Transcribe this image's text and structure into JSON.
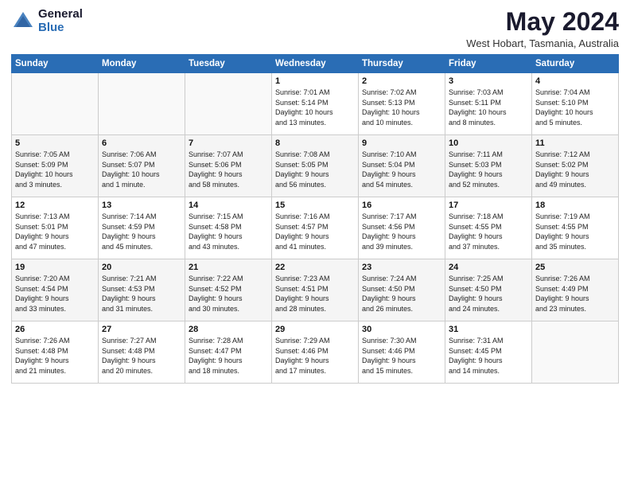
{
  "header": {
    "logo_general": "General",
    "logo_blue": "Blue",
    "month_title": "May 2024",
    "location": "West Hobart, Tasmania, Australia"
  },
  "weekdays": [
    "Sunday",
    "Monday",
    "Tuesday",
    "Wednesday",
    "Thursday",
    "Friday",
    "Saturday"
  ],
  "weeks": [
    [
      {
        "day": "",
        "info": ""
      },
      {
        "day": "",
        "info": ""
      },
      {
        "day": "",
        "info": ""
      },
      {
        "day": "1",
        "info": "Sunrise: 7:01 AM\nSunset: 5:14 PM\nDaylight: 10 hours\nand 13 minutes."
      },
      {
        "day": "2",
        "info": "Sunrise: 7:02 AM\nSunset: 5:13 PM\nDaylight: 10 hours\nand 10 minutes."
      },
      {
        "day": "3",
        "info": "Sunrise: 7:03 AM\nSunset: 5:11 PM\nDaylight: 10 hours\nand 8 minutes."
      },
      {
        "day": "4",
        "info": "Sunrise: 7:04 AM\nSunset: 5:10 PM\nDaylight: 10 hours\nand 5 minutes."
      }
    ],
    [
      {
        "day": "5",
        "info": "Sunrise: 7:05 AM\nSunset: 5:09 PM\nDaylight: 10 hours\nand 3 minutes."
      },
      {
        "day": "6",
        "info": "Sunrise: 7:06 AM\nSunset: 5:07 PM\nDaylight: 10 hours\nand 1 minute."
      },
      {
        "day": "7",
        "info": "Sunrise: 7:07 AM\nSunset: 5:06 PM\nDaylight: 9 hours\nand 58 minutes."
      },
      {
        "day": "8",
        "info": "Sunrise: 7:08 AM\nSunset: 5:05 PM\nDaylight: 9 hours\nand 56 minutes."
      },
      {
        "day": "9",
        "info": "Sunrise: 7:10 AM\nSunset: 5:04 PM\nDaylight: 9 hours\nand 54 minutes."
      },
      {
        "day": "10",
        "info": "Sunrise: 7:11 AM\nSunset: 5:03 PM\nDaylight: 9 hours\nand 52 minutes."
      },
      {
        "day": "11",
        "info": "Sunrise: 7:12 AM\nSunset: 5:02 PM\nDaylight: 9 hours\nand 49 minutes."
      }
    ],
    [
      {
        "day": "12",
        "info": "Sunrise: 7:13 AM\nSunset: 5:01 PM\nDaylight: 9 hours\nand 47 minutes."
      },
      {
        "day": "13",
        "info": "Sunrise: 7:14 AM\nSunset: 4:59 PM\nDaylight: 9 hours\nand 45 minutes."
      },
      {
        "day": "14",
        "info": "Sunrise: 7:15 AM\nSunset: 4:58 PM\nDaylight: 9 hours\nand 43 minutes."
      },
      {
        "day": "15",
        "info": "Sunrise: 7:16 AM\nSunset: 4:57 PM\nDaylight: 9 hours\nand 41 minutes."
      },
      {
        "day": "16",
        "info": "Sunrise: 7:17 AM\nSunset: 4:56 PM\nDaylight: 9 hours\nand 39 minutes."
      },
      {
        "day": "17",
        "info": "Sunrise: 7:18 AM\nSunset: 4:55 PM\nDaylight: 9 hours\nand 37 minutes."
      },
      {
        "day": "18",
        "info": "Sunrise: 7:19 AM\nSunset: 4:55 PM\nDaylight: 9 hours\nand 35 minutes."
      }
    ],
    [
      {
        "day": "19",
        "info": "Sunrise: 7:20 AM\nSunset: 4:54 PM\nDaylight: 9 hours\nand 33 minutes."
      },
      {
        "day": "20",
        "info": "Sunrise: 7:21 AM\nSunset: 4:53 PM\nDaylight: 9 hours\nand 31 minutes."
      },
      {
        "day": "21",
        "info": "Sunrise: 7:22 AM\nSunset: 4:52 PM\nDaylight: 9 hours\nand 30 minutes."
      },
      {
        "day": "22",
        "info": "Sunrise: 7:23 AM\nSunset: 4:51 PM\nDaylight: 9 hours\nand 28 minutes."
      },
      {
        "day": "23",
        "info": "Sunrise: 7:24 AM\nSunset: 4:50 PM\nDaylight: 9 hours\nand 26 minutes."
      },
      {
        "day": "24",
        "info": "Sunrise: 7:25 AM\nSunset: 4:50 PM\nDaylight: 9 hours\nand 24 minutes."
      },
      {
        "day": "25",
        "info": "Sunrise: 7:26 AM\nSunset: 4:49 PM\nDaylight: 9 hours\nand 23 minutes."
      }
    ],
    [
      {
        "day": "26",
        "info": "Sunrise: 7:26 AM\nSunset: 4:48 PM\nDaylight: 9 hours\nand 21 minutes."
      },
      {
        "day": "27",
        "info": "Sunrise: 7:27 AM\nSunset: 4:48 PM\nDaylight: 9 hours\nand 20 minutes."
      },
      {
        "day": "28",
        "info": "Sunrise: 7:28 AM\nSunset: 4:47 PM\nDaylight: 9 hours\nand 18 minutes."
      },
      {
        "day": "29",
        "info": "Sunrise: 7:29 AM\nSunset: 4:46 PM\nDaylight: 9 hours\nand 17 minutes."
      },
      {
        "day": "30",
        "info": "Sunrise: 7:30 AM\nSunset: 4:46 PM\nDaylight: 9 hours\nand 15 minutes."
      },
      {
        "day": "31",
        "info": "Sunrise: 7:31 AM\nSunset: 4:45 PM\nDaylight: 9 hours\nand 14 minutes."
      },
      {
        "day": "",
        "info": ""
      }
    ]
  ]
}
